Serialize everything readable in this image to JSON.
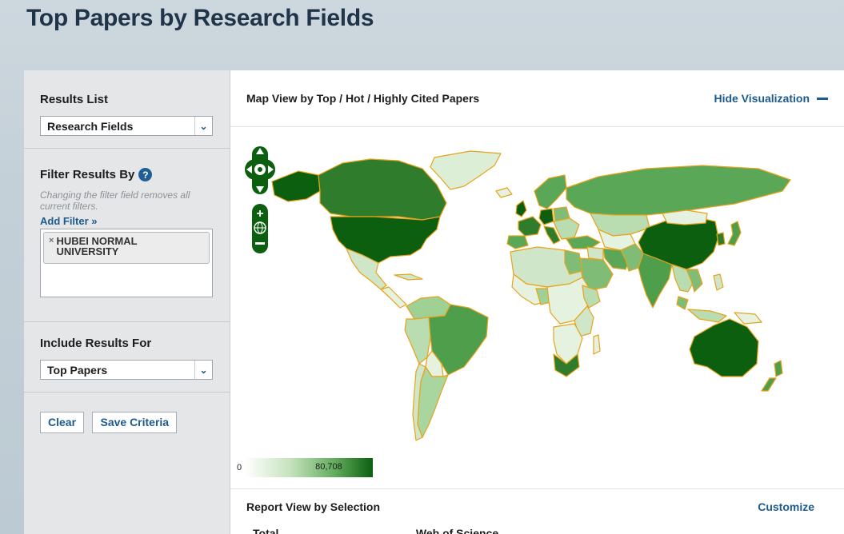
{
  "page": {
    "title": "Top Papers by Research Fields"
  },
  "sidebar": {
    "results_list": {
      "heading": "Results List",
      "selected": "Research Fields"
    },
    "filter": {
      "heading": "Filter Results By",
      "help": "?",
      "hint": "Changing the filter field removes all current filters.",
      "add_filter": "Add Filter »",
      "chip_remove": "×",
      "chips": [
        "HUBEI NORMAL UNIVERSITY"
      ]
    },
    "include": {
      "heading": "Include Results For",
      "selected": "Top Papers"
    },
    "buttons": {
      "clear": "Clear",
      "save": "Save Criteria"
    }
  },
  "main": {
    "title": "Map View by Top / Hot / Highly Cited Papers",
    "hide_label": "Hide Visualization",
    "legend": {
      "min": "0",
      "max": "80,708",
      "colors": [
        "#ffffff",
        "#0b5f0f"
      ]
    },
    "report_title": "Report View by Selection",
    "customize": "Customize",
    "cutoff_col1": "Total",
    "cutoff_col2": "Web of Science"
  },
  "icons": [
    "help-icon",
    "chevron-down-icon",
    "close-icon",
    "pan-control-icon",
    "zoom-in-icon",
    "globe-icon",
    "zoom-out-icon",
    "minus-icon"
  ],
  "colors": {
    "accent": "#1e5a8e",
    "map_border": "#e8a21a",
    "map_dark": "#0b5f0f",
    "map_mid": "#5aa757",
    "map_light": "#d6ebd0"
  }
}
